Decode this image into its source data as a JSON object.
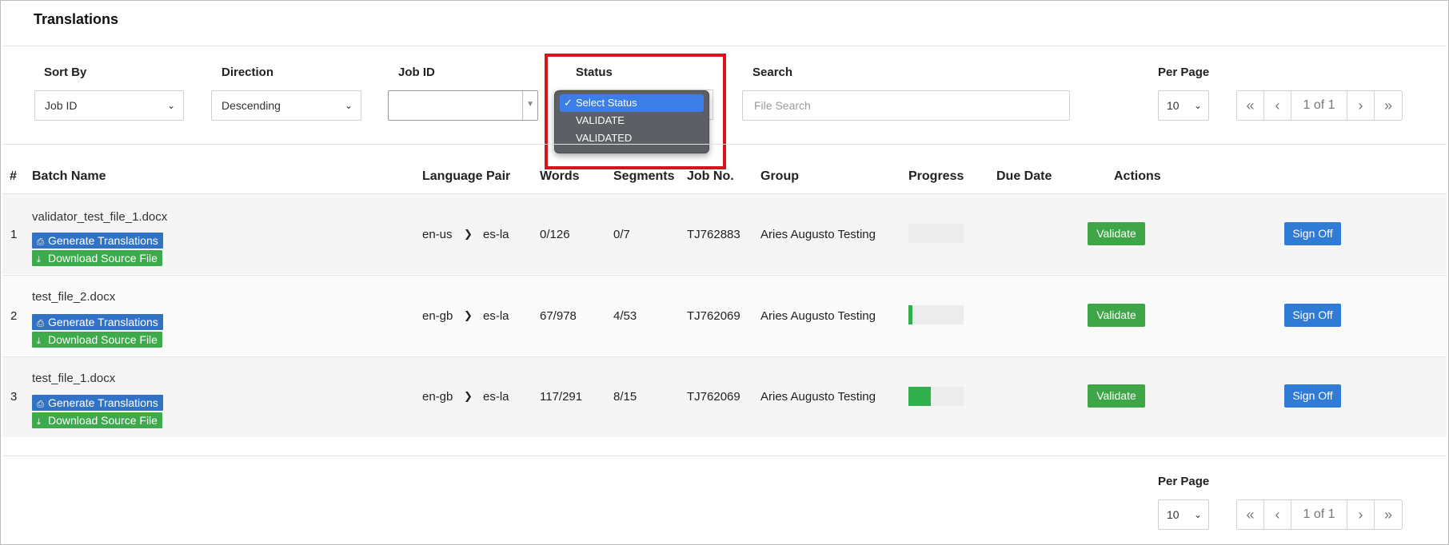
{
  "page": {
    "title": "Translations"
  },
  "filters": {
    "sort_by": {
      "label": "Sort By",
      "value": "Job ID"
    },
    "direction": {
      "label": "Direction",
      "value": "Descending"
    },
    "job_id": {
      "label": "Job ID",
      "value": ""
    },
    "status": {
      "label": "Status",
      "options": [
        "Select Status",
        "VALIDATE",
        "VALIDATED"
      ],
      "selected": "Select Status"
    },
    "search": {
      "label": "Search",
      "placeholder": "File Search"
    },
    "per_page": {
      "label": "Per Page",
      "value": "10"
    }
  },
  "pager": {
    "first": "«",
    "prev": "‹",
    "info": "1 of 1",
    "next": "›",
    "last": "»"
  },
  "table": {
    "headers": [
      "#",
      "Batch Name",
      "Language Pair",
      "Words",
      "Segments",
      "Job No.",
      "Group",
      "Progress",
      "Due Date",
      "Actions"
    ],
    "row_buttons": {
      "generate": "Generate Translations",
      "download": "Download Source File",
      "validate": "Validate",
      "signoff": "Sign Off"
    },
    "rows": [
      {
        "num": "1",
        "batch": "validator_test_file_1.docx",
        "src": "en-us",
        "tgt": "es-la",
        "words": "0/126",
        "segments": "0/7",
        "job": "TJ762883",
        "group": "Aries Augusto Testing",
        "progress": 0,
        "due": ""
      },
      {
        "num": "2",
        "batch": "test_file_2.docx",
        "src": "en-gb",
        "tgt": "es-la",
        "words": "67/978",
        "segments": "4/53",
        "job": "TJ762069",
        "group": "Aries Augusto Testing",
        "progress": 0.075,
        "due": ""
      },
      {
        "num": "3",
        "batch": "test_file_1.docx",
        "src": "en-gb",
        "tgt": "es-la",
        "words": "117/291",
        "segments": "8/15",
        "job": "TJ762069",
        "group": "Aries Augusto Testing",
        "progress": 0.4,
        "due": ""
      }
    ]
  },
  "footer": {
    "per_page_label": "Per Page",
    "per_page_value": "10"
  },
  "colors": {
    "accent_blue": "#3072c6",
    "accent_green": "#3daa4b",
    "highlight_red": "#d9131b",
    "dropdown_selected": "#3b7ee8"
  }
}
